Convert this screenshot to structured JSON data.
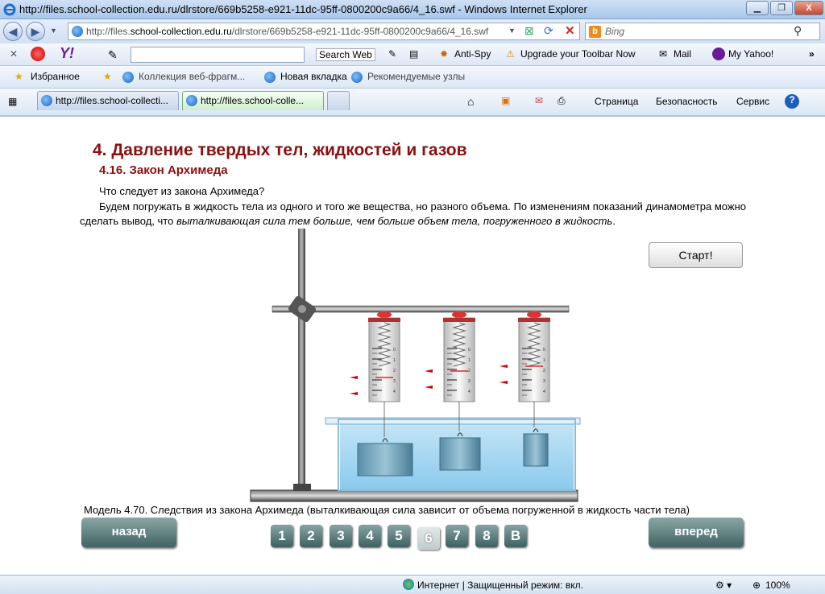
{
  "window": {
    "title": "http://files.school-collection.edu.ru/dlrstore/669b5258-e921-11dc-95ff-0800200c9a66/4_16.swf - Windows Internet Explorer",
    "minimize": "▁",
    "maximize": "❐",
    "close": "X"
  },
  "address_bar": {
    "url_host": "http://files.",
    "url_domain": "school-collection.edu.ru",
    "url_path": "/dlrstore/669b5258-e921-11dc-95ff-0800200c9a66/4_16.swf",
    "search_placeholder": "Bing"
  },
  "toolbar": {
    "search_web": "Search Web",
    "anti_spy": "Anti-Spy",
    "upgrade": "Upgrade your Toolbar Now",
    "mail": "Mail",
    "my_yahoo": "My Yahoo!"
  },
  "favorites_bar": {
    "favorites": "Избранное",
    "items": [
      "Коллекция веб-фрагм...",
      "Новая вкладка",
      "Рекомендуемые узлы"
    ]
  },
  "tabs": [
    {
      "label": "http://files.school-collecti..."
    },
    {
      "label": "http://files.school-colle..."
    }
  ],
  "command_bar": {
    "page": "Страница",
    "safety": "Безопасность",
    "tools": "Сервис"
  },
  "page": {
    "title": "4. Давление твердых тел, жидкостей и газов",
    "subtitle": "4.16. Закон Архимеда",
    "question": "Что следует из закона Архимеда?",
    "para_plain": "Будем погружать в жидкость тела из одного и того же вещества, но разного объема. По изменениям показаний динамометра можно сделать вывод, что ",
    "para_italic": "выталкивающая сила тем больше, чем больше объем тела, погруженного в жидкость",
    "para_end": ".",
    "start_button": "Старт!",
    "caption": "Модель 4.70. Следствия из закона Архимеда (выталкивающая сила зависит от объема погруженной в жидкость части тела)",
    "back_button": "назад",
    "forward_button": "вперед",
    "pages": [
      "1",
      "2",
      "3",
      "4",
      "5",
      "6",
      "7",
      "8",
      "В"
    ],
    "current_page": "6",
    "scale_labels": [
      "0",
      "1",
      "2",
      "3",
      "4"
    ]
  },
  "status_bar": {
    "zone": "Интернет | Защищенный режим: вкл.",
    "zoom": "100%"
  }
}
